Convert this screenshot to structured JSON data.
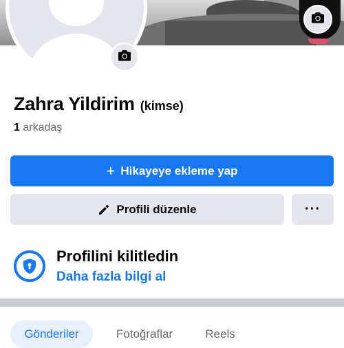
{
  "profile": {
    "name": "Zahra Yildirim",
    "name_suffix": "(kimse)",
    "friends_count": "1",
    "friends_label": "arkadaş"
  },
  "actions": {
    "add_story_label": "Hikayeye ekleme yap",
    "edit_profile_label": "Profili düzenle",
    "more_label": "···"
  },
  "lock_notice": {
    "title": "Profilini kilitledin",
    "link": "Daha fazla bilgi al"
  },
  "tabs": [
    {
      "label": "Gönderiler",
      "active": true
    },
    {
      "label": "Fotoğraflar",
      "active": false
    },
    {
      "label": "Reels",
      "active": false
    }
  ],
  "colors": {
    "accent": "#1877f2",
    "secondary_button": "#e4e6eb",
    "muted_text": "#65676b"
  },
  "icons": [
    "camera-icon",
    "plus-icon",
    "pencil-icon",
    "more-icon",
    "shield-lock-icon"
  ]
}
